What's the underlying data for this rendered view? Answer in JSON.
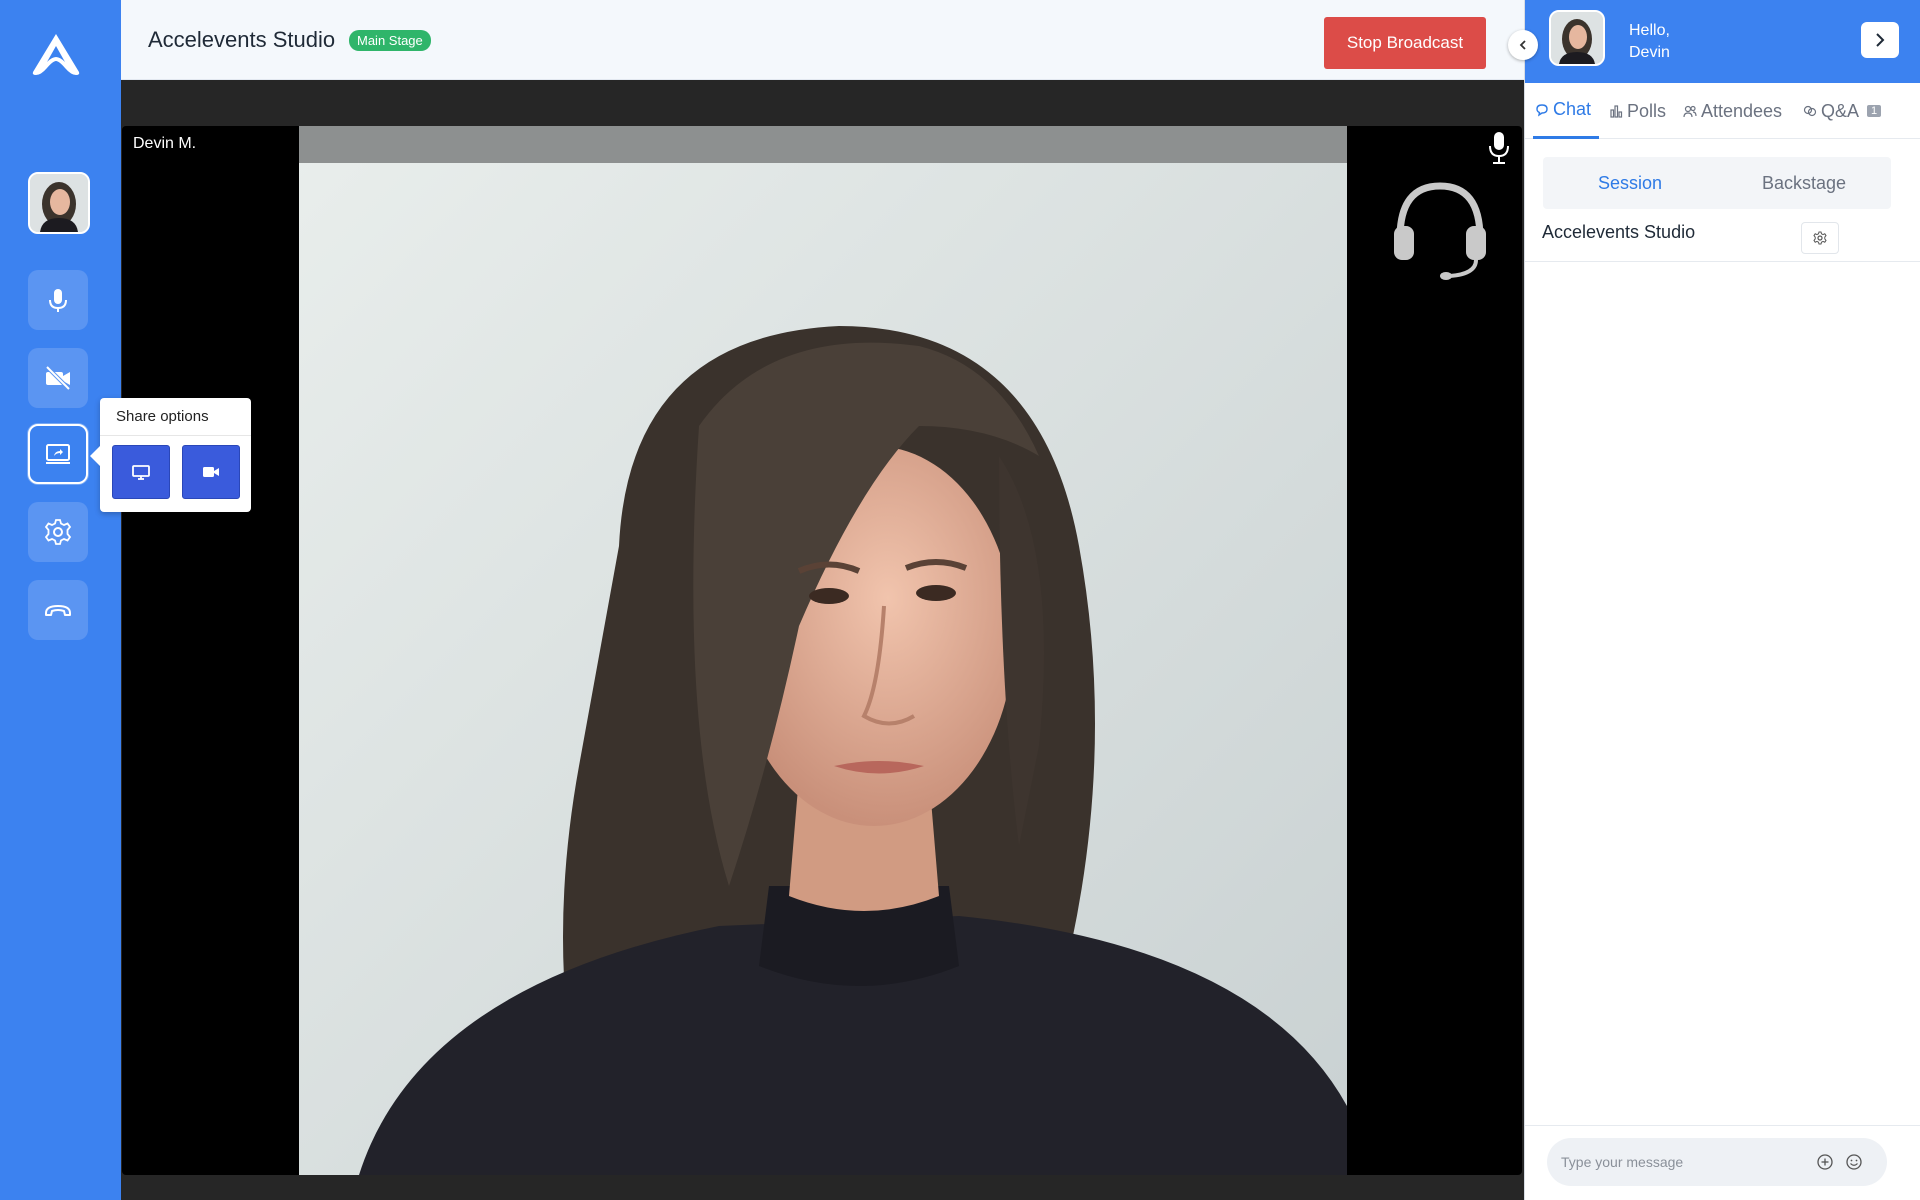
{
  "header": {
    "title": "Accelevents Studio",
    "stage_badge": "Main Stage",
    "stop_button": "Stop Broadcast"
  },
  "left_rail": {
    "icons": [
      "logo-icon",
      "avatar",
      "microphone-icon",
      "video-off-icon",
      "share-screen-icon",
      "gear-icon",
      "hang-up-icon"
    ],
    "share_popover": {
      "title": "Share options",
      "options": [
        "monitor-icon",
        "video-camera-icon"
      ]
    }
  },
  "video": {
    "participant_name": "Devin M."
  },
  "right_panel": {
    "greeting_line1": "Hello,",
    "greeting_line2": "Devin",
    "tabs": [
      {
        "label": "Chat",
        "icon": "chat-icon",
        "active": true
      },
      {
        "label": "Polls",
        "icon": "bar-chart-icon",
        "active": false
      },
      {
        "label": "Attendees",
        "icon": "users-icon",
        "active": false
      },
      {
        "label": "Q&A",
        "icon": "qa-icon",
        "count": "1",
        "active": false
      }
    ],
    "segments": {
      "session": "Session",
      "backstage": "Backstage",
      "selected": "Session"
    },
    "chat_title": "Accelevents Studio",
    "message_placeholder": "Type your message"
  },
  "colors": {
    "brand_blue": "#3c82f0",
    "stop_red": "#dc4c48",
    "badge_green": "#2fb56a",
    "share_button_blue": "#3a5bdc",
    "active_tab_blue": "#2f7be6"
  }
}
